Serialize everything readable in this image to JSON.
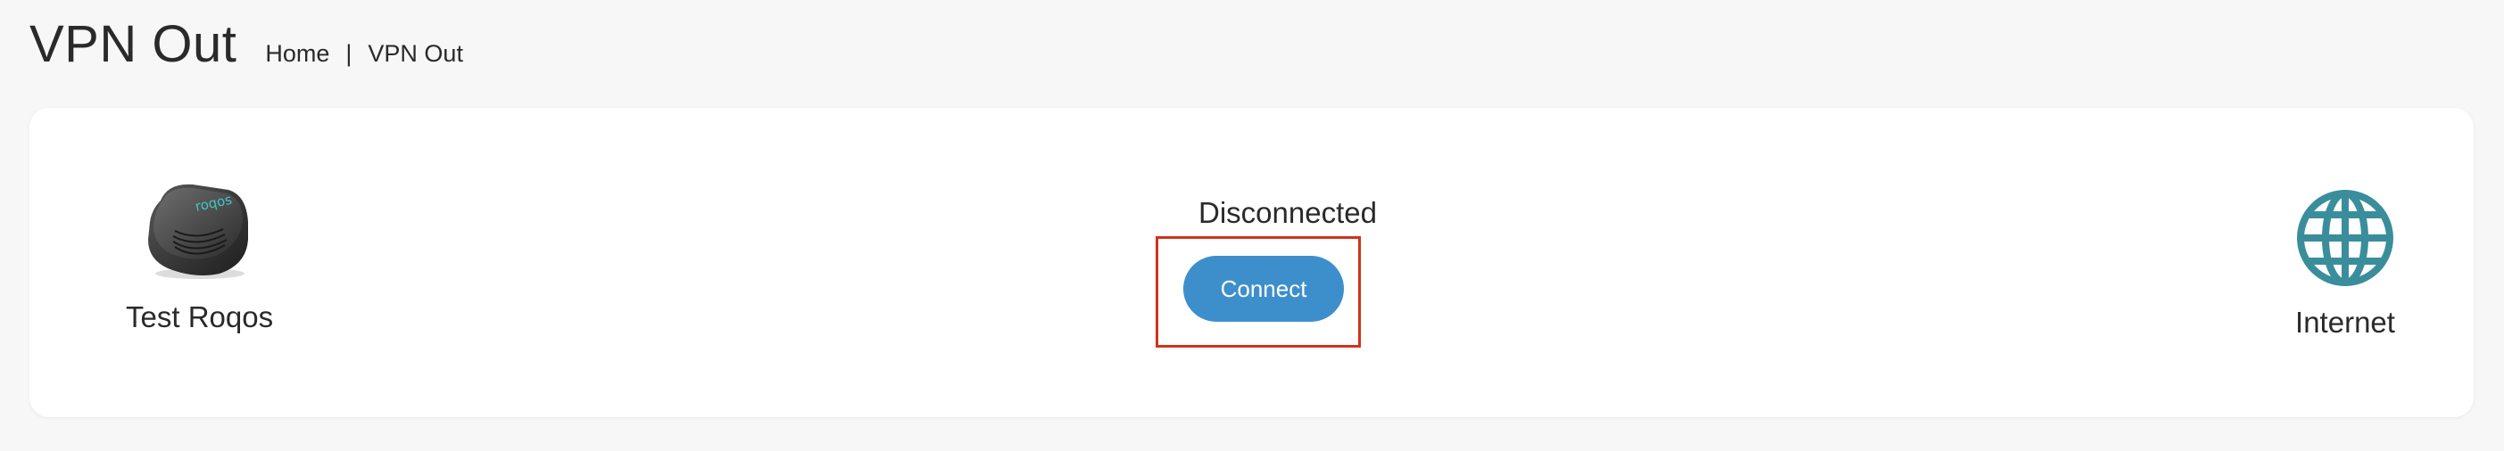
{
  "page": {
    "title": "VPN Out"
  },
  "breadcrumb": {
    "home": "Home",
    "separator": "|",
    "current": "VPN Out"
  },
  "vpn": {
    "device_name": "Test Roqos",
    "device_icon": "router-device-icon",
    "device_brand_text": "roqos",
    "status": "Disconnected",
    "connect_label": "Connect",
    "destination_label": "Internet",
    "destination_icon": "globe-icon"
  },
  "colors": {
    "background": "#f7f7f7",
    "card": "#ffffff",
    "button": "#3d8fcc",
    "button_text": "#ffffff",
    "highlight": "#d1331b",
    "globe": "#3a8e9b"
  }
}
